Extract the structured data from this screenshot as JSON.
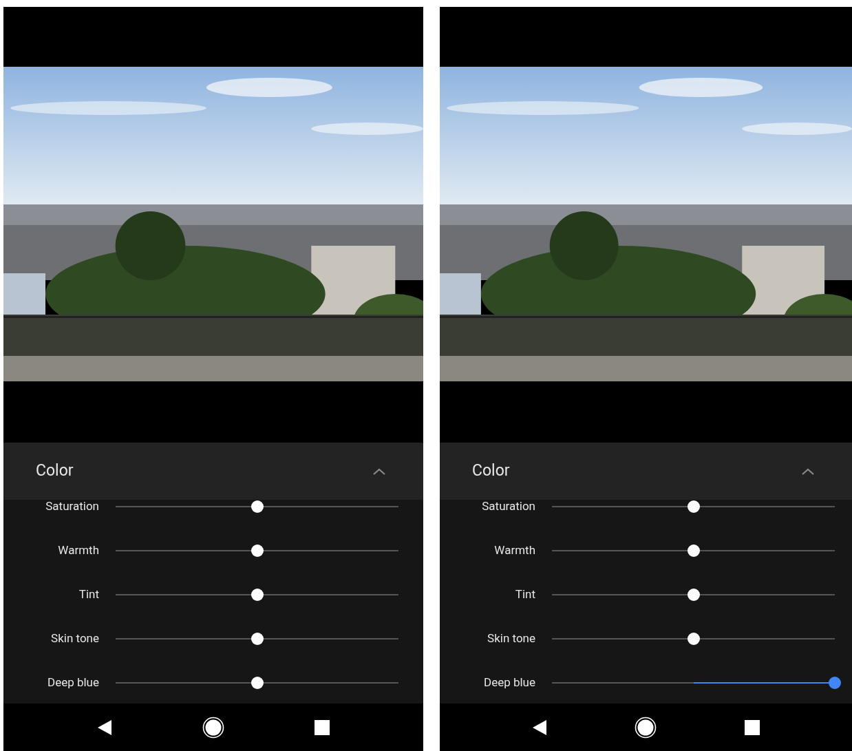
{
  "screens": [
    {
      "panel": {
        "title": "Color",
        "sliders": [
          {
            "label": "Saturation",
            "level": 0.5
          },
          {
            "label": "Warmth",
            "level": 0.5
          },
          {
            "label": "Tint",
            "level": 0.5
          },
          {
            "label": "Skin tone",
            "level": 0.5
          },
          {
            "label": "Deep blue",
            "level": 0.5
          }
        ]
      }
    },
    {
      "panel": {
        "title": "Color",
        "sliders": [
          {
            "label": "Saturation",
            "level": 0.5
          },
          {
            "label": "Warmth",
            "level": 0.5
          },
          {
            "label": "Tint",
            "level": 0.5
          },
          {
            "label": "Skin tone",
            "level": 0.5
          },
          {
            "label": "Deep blue",
            "level": 1
          }
        ]
      }
    }
  ]
}
